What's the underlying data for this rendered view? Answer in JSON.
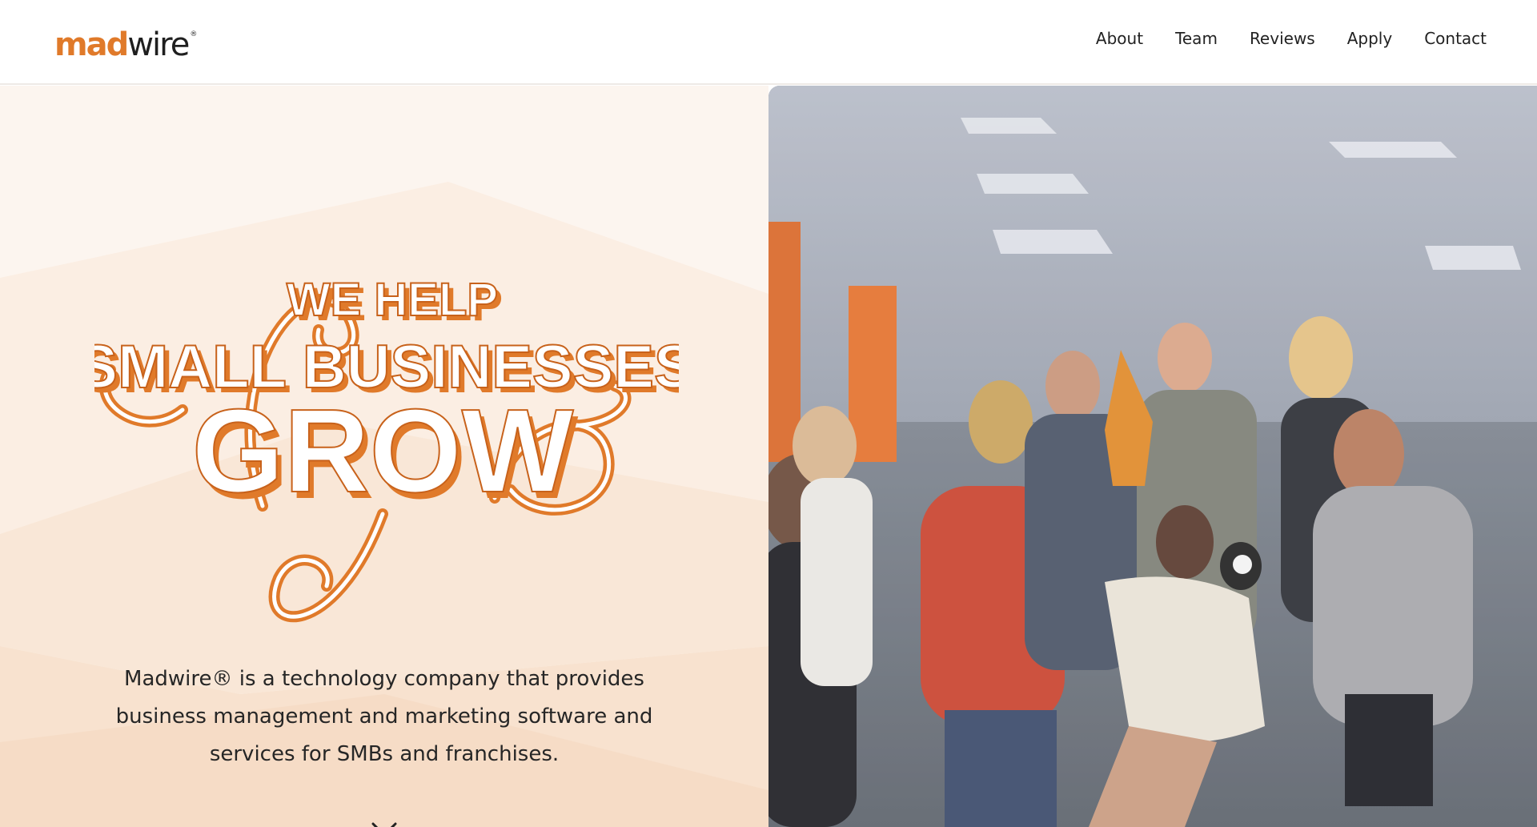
{
  "brand": {
    "logo_prefix": "mad",
    "logo_suffix": "wire",
    "logo_mark": "®",
    "accent_color": "#e07a2a"
  },
  "nav": {
    "items": [
      {
        "label": "About"
      },
      {
        "label": "Team"
      },
      {
        "label": "Reviews"
      },
      {
        "label": "Apply"
      },
      {
        "label": "Contact"
      }
    ]
  },
  "hero": {
    "headline": {
      "line1": "WE HELP",
      "line2": "SMALL BUSINESSES",
      "line3": "GROW"
    },
    "tagline_line1": "Madwire® is a technology company that provides",
    "tagline_line2": "business management and marketing software and",
    "tagline_line3": "services for SMBs and franchises.",
    "scroll_icon": "chevron-down-icon",
    "media": "team celebration video"
  }
}
